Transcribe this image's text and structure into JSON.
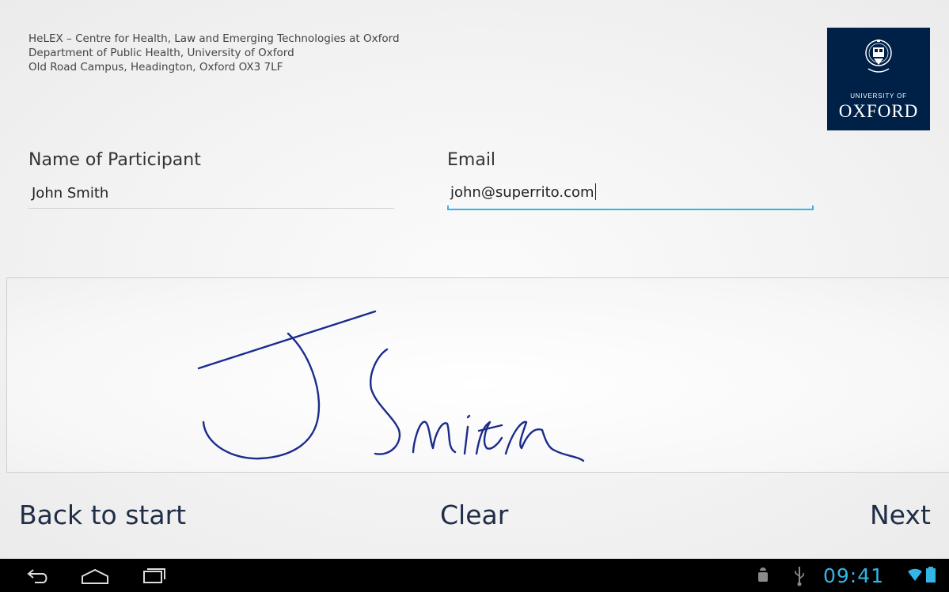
{
  "header": {
    "address_lines": [
      "HeLEX – Centre for Health, Law and Emerging Technologies at Oxford",
      "Department of Public Health, University of Oxford",
      "Old Road Campus, Headington, Oxford OX3 7LF"
    ],
    "logo": {
      "line1": "UNIVERSITY OF",
      "line2": "OXFORD",
      "color": "#002147"
    }
  },
  "form": {
    "name_label": "Name of Participant",
    "name_value": "John Smith",
    "email_label": "Email",
    "email_value": "john@superrito.com"
  },
  "signature": {
    "icon": "signature-pad",
    "ink_color": "#1c2b8c"
  },
  "buttons": {
    "back": "Back to start",
    "clear": "Clear",
    "next": "Next"
  },
  "system_bar": {
    "time": "09:41",
    "accent_color": "#33b5e5",
    "icons": [
      "back-icon",
      "home-icon",
      "recent-apps-icon",
      "android-debug-icon",
      "usb-icon",
      "wifi-icon",
      "battery-icon"
    ]
  }
}
